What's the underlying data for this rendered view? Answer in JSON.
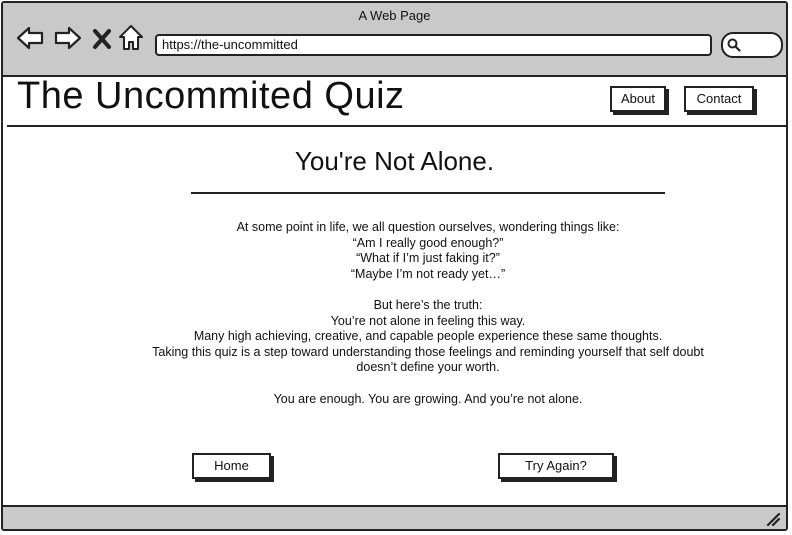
{
  "window": {
    "title": "A Web Page"
  },
  "browser": {
    "url": "https://the-uncommitted",
    "icons": [
      "back-arrow-icon",
      "forward-arrow-icon",
      "close-x-icon",
      "home-icon",
      "search-icon"
    ]
  },
  "header": {
    "site_title": "The Uncommited Quiz",
    "nav": {
      "about": "About",
      "contact": "Contact"
    }
  },
  "main": {
    "heading": "You're Not Alone.",
    "paragraph1": [
      "At some point in life, we all question ourselves, wondering things like:",
      "“Am I really good enough?”",
      "“What if I’m just faking it?”",
      "“Maybe I’m not ready yet…”"
    ],
    "paragraph2": [
      "But here’s the truth:",
      "You’re not alone in feeling this way.",
      "Many high achieving, creative, and capable people experience these same thoughts.",
      "Taking this quiz is a step toward understanding those feelings and reminding yourself that self doubt doesn’t define your worth."
    ],
    "closing": "You are enough. You are growing. And you’re not alone."
  },
  "actions": {
    "home": "Home",
    "try_again": "Try Again?"
  }
}
